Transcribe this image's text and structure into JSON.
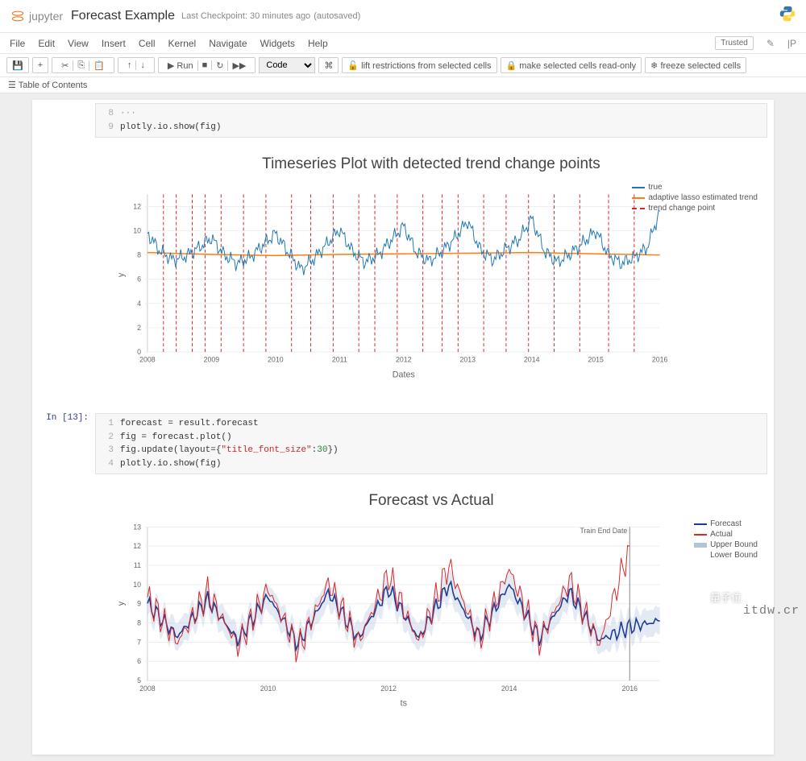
{
  "header": {
    "logo_text": "jupyter",
    "notebook_title": "Forecast Example",
    "checkpoint_text": "Last Checkpoint: 30 minutes ago",
    "autosave_text": "(autosaved)"
  },
  "menubar": {
    "items": [
      "File",
      "Edit",
      "View",
      "Insert",
      "Cell",
      "Kernel",
      "Navigate",
      "Widgets",
      "Help"
    ],
    "trusted_label": "Trusted"
  },
  "toolbar": {
    "save_icon": "💾",
    "add_icon": "+",
    "cut_icon": "✂",
    "copy_icon": "⎘",
    "paste_icon": "📋",
    "up_icon": "↑",
    "down_icon": "↓",
    "run_label": "▶ Run",
    "stop_icon": "■",
    "restart_icon": "↻",
    "ff_icon": "▶▶",
    "cell_type": "Code",
    "cmd_icon": "⌘",
    "lift_label": "🔓 lift restrictions from selected cells",
    "readonly_label": "🔒 make selected cells read-only",
    "freeze_label": "❄ freeze selected cells"
  },
  "toc": {
    "label": "☰ Table of Contents"
  },
  "cell1": {
    "prompt": "",
    "line_a_num": "8",
    "line_b_num": "9",
    "line_b": "plotly.io.show(fig)"
  },
  "chart1": {
    "title": "Timeseries Plot with detected trend change points",
    "ylabel": "y",
    "xlabel": "Dates",
    "legend": [
      {
        "name": "true",
        "color": "#1f77b4",
        "dash": "solid"
      },
      {
        "name": "adaptive lasso estimated trend",
        "color": "#ff7f0e",
        "dash": "solid"
      },
      {
        "name": "trend change point",
        "color": "#d62728",
        "dash": "dash"
      }
    ],
    "x_ticks": [
      "2008",
      "2009",
      "2010",
      "2011",
      "2012",
      "2013",
      "2014",
      "2015",
      "2016"
    ],
    "y_ticks": [
      0,
      2,
      4,
      6,
      8,
      10,
      12
    ]
  },
  "cell2": {
    "prompt": "In [13]:",
    "lines": [
      {
        "n": "1",
        "t": "forecast = result.forecast"
      },
      {
        "n": "2",
        "t": "fig = forecast.plot()"
      },
      {
        "n": "3",
        "t_pre": "fig.update(layout={",
        "t_str": "\"title_font_size\"",
        "t_mid": ": ",
        "t_num": "30",
        "t_post": "})"
      },
      {
        "n": "4",
        "t": "plotly.io.show(fig)"
      }
    ]
  },
  "chart2": {
    "title": "Forecast vs Actual",
    "ylabel": "y",
    "xlabel": "ts",
    "train_end_label": "Train End Date",
    "legend": [
      {
        "name": "Forecast",
        "color": "#1f3a93"
      },
      {
        "name": "Actual",
        "color": "#d62728"
      },
      {
        "name": "Upper Bound",
        "color": "#b0c4de"
      },
      {
        "name": "Lower Bound",
        "color": "#b0c4de"
      }
    ],
    "x_ticks": [
      "2008",
      "2010",
      "2012",
      "2014",
      "2016"
    ],
    "y_ticks": [
      5,
      6,
      7,
      8,
      9,
      10,
      11,
      12,
      13
    ]
  },
  "chart_data": [
    {
      "type": "line",
      "title": "Timeseries Plot with detected trend change points",
      "xlabel": "Dates",
      "ylabel": "y",
      "xlim": [
        2008,
        2016
      ],
      "ylim": [
        0,
        13
      ],
      "series": [
        {
          "name": "true",
          "color": "#1f77b4",
          "x": [
            2008,
            2008.2,
            2008.4,
            2008.6,
            2008.8,
            2009,
            2009.2,
            2009.4,
            2009.6,
            2009.8,
            2010,
            2010.2,
            2010.4,
            2010.6,
            2010.8,
            2011,
            2011.2,
            2011.4,
            2011.6,
            2011.8,
            2012,
            2012.2,
            2012.4,
            2012.6,
            2012.8,
            2013,
            2013.2,
            2013.4,
            2013.6,
            2013.8,
            2014,
            2014.2,
            2014.4,
            2014.6,
            2014.8,
            2015,
            2015.2,
            2015.4,
            2015.6,
            2015.8,
            2016
          ],
          "y": [
            9.8,
            8.3,
            7.6,
            7.9,
            8.6,
            9.4,
            8.0,
            7.3,
            7.8,
            8.8,
            9.8,
            8.2,
            6.8,
            7.7,
            8.9,
            10.1,
            8.3,
            7.4,
            8.0,
            9.2,
            10.4,
            8.2,
            7.5,
            8.3,
            9.4,
            10.8,
            8.4,
            7.6,
            8.5,
            9.3,
            11.0,
            8.3,
            7.4,
            8.1,
            9.0,
            10.0,
            8.0,
            7.3,
            7.8,
            8.6,
            11.6
          ]
        },
        {
          "name": "adaptive lasso estimated trend",
          "color": "#ff7f0e",
          "x": [
            2008,
            2009,
            2010,
            2011,
            2012,
            2013,
            2014,
            2015,
            2016
          ],
          "y": [
            8.2,
            8.05,
            7.95,
            8.05,
            8.1,
            8.15,
            8.2,
            8.1,
            8.0
          ]
        }
      ],
      "vlines": {
        "name": "trend change point",
        "color": "#d62728",
        "x": [
          2008.25,
          2008.45,
          2008.7,
          2008.9,
          2009.15,
          2009.5,
          2009.85,
          2010.25,
          2010.55,
          2010.9,
          2011.3,
          2011.55,
          2011.9,
          2012.3,
          2012.6,
          2012.85,
          2013.25,
          2013.6,
          2013.95,
          2014.35,
          2014.75,
          2015.2,
          2015.6
        ]
      }
    },
    {
      "type": "line",
      "title": "Forecast vs Actual",
      "xlabel": "ts",
      "ylabel": "y",
      "xlim": [
        2008,
        2016.5
      ],
      "ylim": [
        5,
        13
      ],
      "annotations": [
        {
          "text": "Train End Date",
          "x": 2016,
          "y": 13
        }
      ],
      "series": [
        {
          "name": "Forecast",
          "color": "#1f3a93",
          "x": [
            2008,
            2008.5,
            2009,
            2009.5,
            2010,
            2010.5,
            2011,
            2011.5,
            2012,
            2012.5,
            2013,
            2013.5,
            2014,
            2014.5,
            2015,
            2015.5,
            2016,
            2016.5
          ],
          "y": [
            9.0,
            7.3,
            9.2,
            7.1,
            9.4,
            6.9,
            9.6,
            7.2,
            9.8,
            7.2,
            10.0,
            7.3,
            10.0,
            7.2,
            9.6,
            7.1,
            7.8,
            8.1
          ]
        },
        {
          "name": "Actual",
          "color": "#d62728",
          "x": [
            2008,
            2008.5,
            2009,
            2009.5,
            2010,
            2010.5,
            2011,
            2011.5,
            2012,
            2012.5,
            2013,
            2013.5,
            2014,
            2014.5,
            2015,
            2015.5,
            2016
          ],
          "y": [
            9.3,
            7.0,
            9.6,
            6.8,
            9.8,
            6.6,
            10.1,
            7.0,
            10.5,
            7.0,
            11.0,
            7.1,
            10.8,
            7.0,
            10.2,
            6.9,
            12.0
          ]
        },
        {
          "name": "Upper Bound",
          "color": "#b0c4de",
          "x": [
            2008,
            2016.5
          ],
          "y": [
            10.5,
            9.0
          ]
        },
        {
          "name": "Lower Bound",
          "color": "#b0c4de",
          "x": [
            2008,
            2016.5
          ],
          "y": [
            6.2,
            6.4
          ]
        }
      ]
    }
  ],
  "watermark": {
    "wechat_text": "量子位",
    "url_text": "itdw.cr"
  }
}
